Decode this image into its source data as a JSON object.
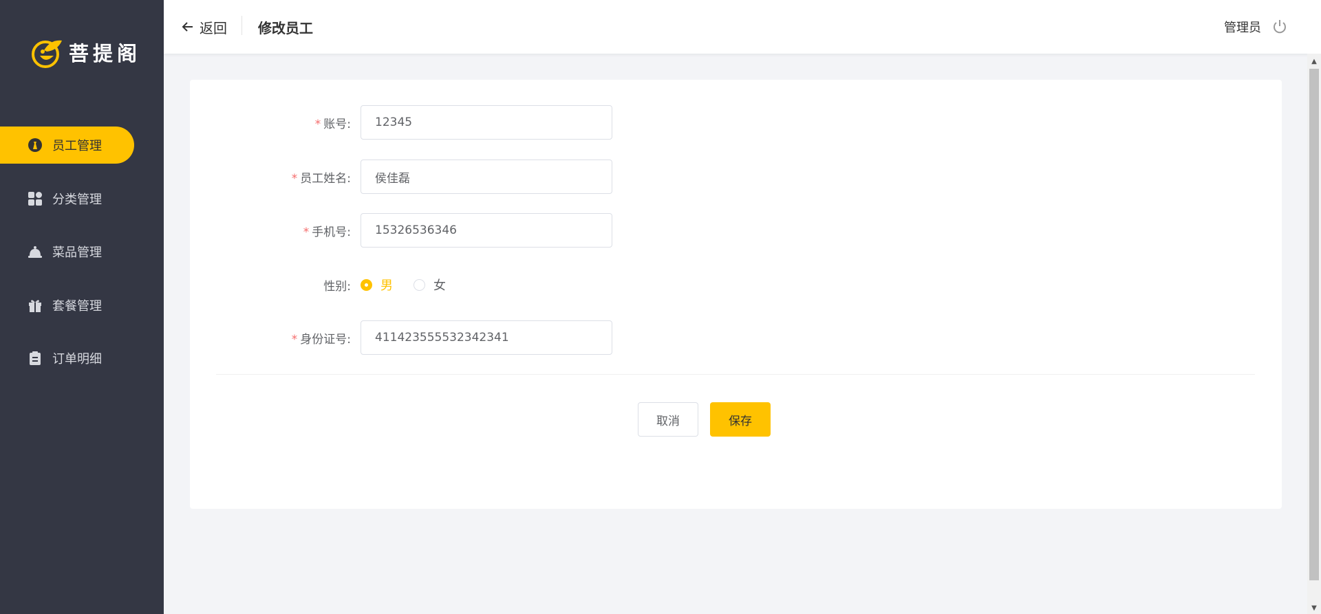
{
  "app": {
    "name": "菩提阁"
  },
  "sidebar": {
    "items": [
      {
        "label": "员工管理",
        "icon": "employee-icon",
        "active": true
      },
      {
        "label": "分类管理",
        "icon": "category-icon",
        "active": false
      },
      {
        "label": "菜品管理",
        "icon": "dish-icon",
        "active": false
      },
      {
        "label": "套餐管理",
        "icon": "gift-icon",
        "active": false
      },
      {
        "label": "订单明细",
        "icon": "clipboard-icon",
        "active": false
      }
    ]
  },
  "header": {
    "back_label": "返回",
    "title": "修改员工",
    "user": "管理员"
  },
  "form": {
    "account": {
      "label": "账号:",
      "value": "12345",
      "required": true
    },
    "name": {
      "label": "员工姓名:",
      "value": "侯佳磊",
      "required": true
    },
    "phone": {
      "label": "手机号:",
      "value": "15326536346",
      "required": true
    },
    "gender": {
      "label": "性别:",
      "options": [
        "男",
        "女"
      ],
      "selected": "男"
    },
    "id_number": {
      "label": "身份证号:",
      "value": "411423555532342341",
      "required": true
    },
    "required_mark": "*"
  },
  "buttons": {
    "cancel": "取消",
    "save": "保存"
  },
  "colors": {
    "accent": "#ffc200",
    "sidebar": "#343744",
    "background": "#f3f4f7"
  }
}
